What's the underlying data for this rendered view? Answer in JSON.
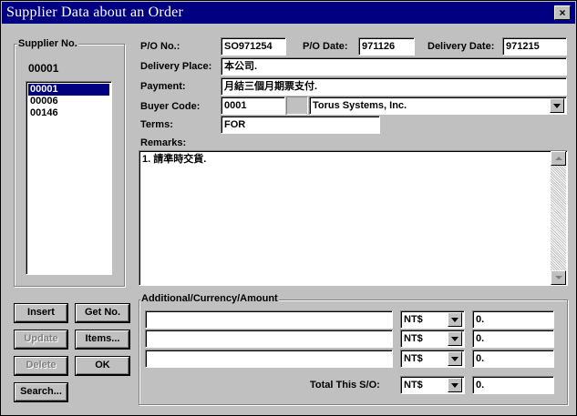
{
  "window": {
    "title": "Supplier Data about an Order",
    "close_symbol": "×"
  },
  "supplier": {
    "group_label": "Supplier No.",
    "current": "00001",
    "list": [
      "00001",
      "00006",
      "00146"
    ]
  },
  "order": {
    "po_no_label": "P/O No.:",
    "po_no": "SO971254",
    "po_date_label": "P/O Date:",
    "po_date": "971126",
    "delivery_date_label": "Delivery Date:",
    "delivery_date": "971215",
    "delivery_place_label": "Delivery Place:",
    "delivery_place": "本公司.",
    "payment_label": "Payment:",
    "payment": "月結三個月期票支付.",
    "buyer_code_label": "Buyer Code:",
    "buyer_code": "0001",
    "buyer_name": "Torus Systems, Inc.",
    "terms_label": "Terms:",
    "terms": "FOR",
    "remarks_label": "Remarks:",
    "remarks": "1. 請準時交貨."
  },
  "additional": {
    "group_label": "Additional/Currency/Amount",
    "rows": [
      {
        "desc": "",
        "currency": "NT$",
        "amount": "0."
      },
      {
        "desc": "",
        "currency": "NT$",
        "amount": "0."
      },
      {
        "desc": "",
        "currency": "NT$",
        "amount": "0."
      }
    ],
    "total_label": "Total This S/O:",
    "total_currency": "NT$",
    "total_amount": "0."
  },
  "buttons": {
    "insert": "Insert",
    "get_no": "Get No.",
    "update": "Update",
    "items": "Items...",
    "delete": "Delete",
    "ok": "OK",
    "search": "Search..."
  }
}
